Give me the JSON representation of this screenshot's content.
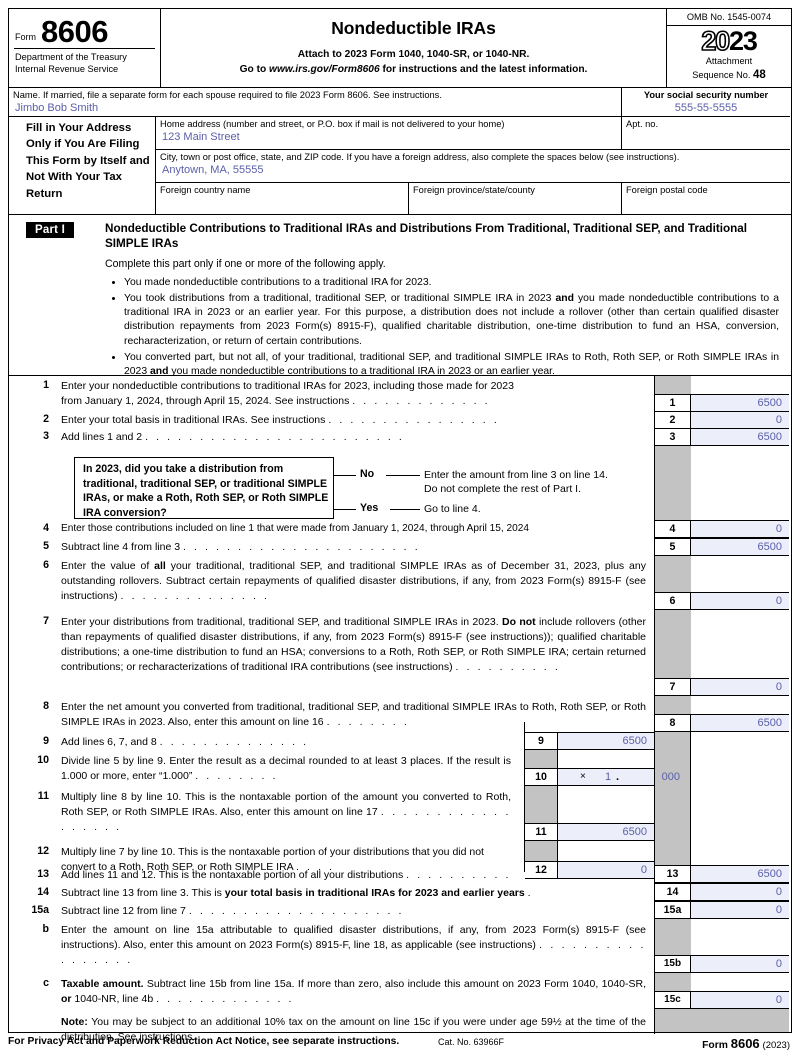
{
  "header": {
    "form_label": "Form",
    "form_number": "8606",
    "department_line1": "Department of the Treasury",
    "department_line2": "Internal Revenue Service",
    "title": "Nondeductible IRAs",
    "attach_line": "Attach to 2023 Form 1040, 1040-SR, or 1040-NR.",
    "goto_prefix": "Go to",
    "goto_url": "www.irs.gov/Form8606",
    "goto_suffix": "for instructions and the latest information.",
    "omb": "OMB No. 1545-0074",
    "year_hollow": "20",
    "year_solid": "23",
    "attachment_label_line1": "Attachment",
    "attachment_label_line2": "Sequence No.",
    "attachment_seq": "48"
  },
  "taxpayer": {
    "name_label": "Name. If married, file a separate form for each spouse required to file 2023 Form 8606. See instructions.",
    "name_value": "Jimbo Bob Smith",
    "ssn_label": "Your social security number",
    "ssn_value": "555-55-5555",
    "side_note": "Fill in Your Address Only if You Are Filing This Form by Itself and Not With Your Tax Return",
    "home_address_label": "Home address (number and street, or P.O. box if mail is not delivered to your home)",
    "home_address_value": "123 Main Street",
    "apt_label": "Apt. no.",
    "apt_value": "",
    "city_label": "City, town or post office, state, and ZIP code. If you have a foreign address, also complete the spaces below (see instructions).",
    "city_value": "Anytown, MA, 55555",
    "foreign_country_label": "Foreign country name",
    "foreign_country_value": "",
    "foreign_province_label": "Foreign province/state/county",
    "foreign_province_value": "",
    "foreign_postal_label": "Foreign postal code",
    "foreign_postal_value": ""
  },
  "part1": {
    "tag": "Part I",
    "title": "Nondeductible Contributions to Traditional IRAs and Distributions From Traditional, Traditional SEP, and Traditional SIMPLE IRAs",
    "subtitle": "Complete this part only if one or more of the following apply.",
    "bullet1": "You made nondeductible contributions to a traditional IRA for 2023.",
    "bullet2_a": "You took distributions from a traditional, traditional SEP, or traditional SIMPLE IRA in 2023 ",
    "bullet2_and": "and",
    "bullet2_b": " you made nondeductible contributions to a traditional IRA in 2023 or an earlier year. For this purpose, a distribution does not include a rollover (other than certain qualified disaster distribution repayments from 2023 Form(s) 8915-F), qualified charitable distribution, one-time distribution to fund an HSA, conversion, recharacterization, or return of certain contributions.",
    "bullet3_a": "You converted part, but not all, of your traditional, traditional SEP, and traditional SIMPLE IRAs to Roth, Roth SEP, or Roth SIMPLE IRAs in 2023 ",
    "bullet3_and": "and",
    "bullet3_b": " you made nondeductible contributions to a traditional IRA in 2023 or an earlier year."
  },
  "decision": {
    "question": "In 2023, did you take a distribution from traditional, traditional SEP, or traditional SIMPLE IRAs, or make a Roth, Roth SEP, or Roth SIMPLE IRA conversion?",
    "no_label": "No",
    "no_text_line1": "Enter the amount from line 3 on line 14.",
    "no_text_line2": "Do not complete the rest of Part I.",
    "yes_label": "Yes",
    "yes_text": "Go to line 4."
  },
  "lines": {
    "l1": {
      "no": "1",
      "text_a": "Enter your nondeductible contributions to traditional IRAs for 2023, including those made for 2023",
      "text_b": "from January 1, 2024, through April 15, 2024. See instructions",
      "value": "6500"
    },
    "l2": {
      "no": "2",
      "text": "Enter your total basis in traditional IRAs. See instructions",
      "value": "0"
    },
    "l3": {
      "no": "3",
      "text": "Add lines 1 and 2",
      "value": "6500"
    },
    "l4": {
      "no": "4",
      "text": "Enter those contributions included on line 1 that were made from January 1, 2024, through April 15, 2024",
      "value": "0"
    },
    "l5": {
      "no": "5",
      "text": "Subtract line 4 from line 3",
      "value": "6500"
    },
    "l6": {
      "no": "6",
      "text_a": "Enter the value of ",
      "text_all": "all",
      "text_b": " your traditional, traditional SEP, and traditional SIMPLE IRAs as of December 31, 2023, plus any outstanding rollovers. Subtract certain repayments of qualified disaster distributions, if any, from 2023 Form(s) 8915-F (see instructions)",
      "value": "0"
    },
    "l7": {
      "no": "7",
      "text_a": "Enter your distributions from traditional, traditional SEP, and traditional SIMPLE IRAs in 2023. ",
      "text_donot": "Do not",
      "text_b": " include rollovers (other than repayments of qualified disaster distributions, if any, from 2023 Form(s) 8915-F (see instructions)); qualified charitable distributions; a one-time distribution to fund an HSA; conversions to a Roth, Roth SEP, or Roth SIMPLE IRA; certain returned contributions; or recharacterizations of traditional IRA contributions (see instructions)",
      "value": "0"
    },
    "l8": {
      "no": "8",
      "text": "Enter the net amount you converted from traditional, traditional SEP, and traditional SIMPLE IRAs to Roth, Roth SEP, or Roth SIMPLE IRAs in 2023. Also, enter this amount on line 16",
      "value": "6500"
    },
    "l9": {
      "no": "9",
      "text": "Add lines 6, 7, and 8",
      "value": "6500"
    },
    "l10": {
      "no": "10",
      "text": "Divide line 5 by line 9. Enter the result as a decimal rounded to at least 3 places. If the result is 1.000 or more, enter “1.000”",
      "multiplier_symbol": "×",
      "whole": "1",
      "decimal_point": ".",
      "decimals": "000"
    },
    "l11": {
      "no": "11",
      "text": "Multiply line 8 by line 10. This is the nontaxable portion of the amount you converted to Roth, Roth SEP, or Roth SIMPLE IRAs. Also, enter this amount on line 17",
      "value": "6500"
    },
    "l12": {
      "no": "12",
      "text": "Multiply line 7 by line 10. This is the nontaxable portion of your distributions that you did not convert to a Roth, Roth SEP, or Roth SIMPLE IRA",
      "value": "0"
    },
    "l13": {
      "no": "13",
      "text": "Add lines 11 and 12. This is the nontaxable portion of all your distributions",
      "value": "6500"
    },
    "l14": {
      "no": "14",
      "text_a": "Subtract line 13 from line 3. This is ",
      "text_bold": "your total basis in traditional IRAs for 2023 and earlier years",
      "value": "0"
    },
    "l15a": {
      "no": "15a",
      "text": "Subtract line 12 from line 7",
      "value": "0"
    },
    "l15b": {
      "no": "15b",
      "letter": "b",
      "text": "Enter the amount on line 15a attributable to qualified disaster distributions, if any, from 2023 Form(s) 8915-F (see instructions). Also, enter this amount on 2023 Form(s) 8915-F, line 18, as applicable (see instructions)",
      "value": "0"
    },
    "l15c": {
      "no": "15c",
      "letter": "c",
      "text_bold": "Taxable amount.",
      "text_a": " Subtract line 15b from line 15a. If more than zero, also include this amount on 2023 Form 1040, 1040-SR, ",
      "text_or": "or",
      "text_b": " 1040-NR, line 4b",
      "value": "0"
    },
    "note": {
      "label": "Note:",
      "text": " You may be subject to an additional 10% tax on the amount on line 15c if you were under age 59½ at the time of the distribution. See instructions."
    }
  },
  "footer": {
    "privacy": "For Privacy Act and Paperwork Reduction Act Notice, see separate instructions.",
    "cat": "Cat. No. 63966F",
    "form_label": "Form",
    "form_number": "8606",
    "year": "(2023)"
  },
  "colors": {
    "field_fill": "#eceefa",
    "value_text": "#5a5fa8",
    "gray_block": "#c3c3c3"
  }
}
